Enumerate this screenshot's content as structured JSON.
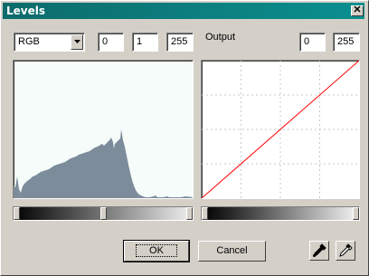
{
  "window": {
    "title": "Levels"
  },
  "input": {
    "channel": "RGB",
    "black": "0",
    "gamma": "1",
    "white": "255"
  },
  "output": {
    "label": "Output",
    "black": "0",
    "white": "255"
  },
  "buttons": {
    "ok": "OK",
    "cancel": "Cancel"
  },
  "icons": {
    "close": "close-icon",
    "dropdown": "chevron-down-icon",
    "black_eyedropper": "eyedropper-black-icon",
    "white_eyedropper": "eyedropper-white-icon"
  },
  "colors": {
    "titlebar": "#0b8080",
    "histogram_fill": "#7d8c9a",
    "curve": "#ff0000",
    "grid": "#c8c8c8"
  }
}
